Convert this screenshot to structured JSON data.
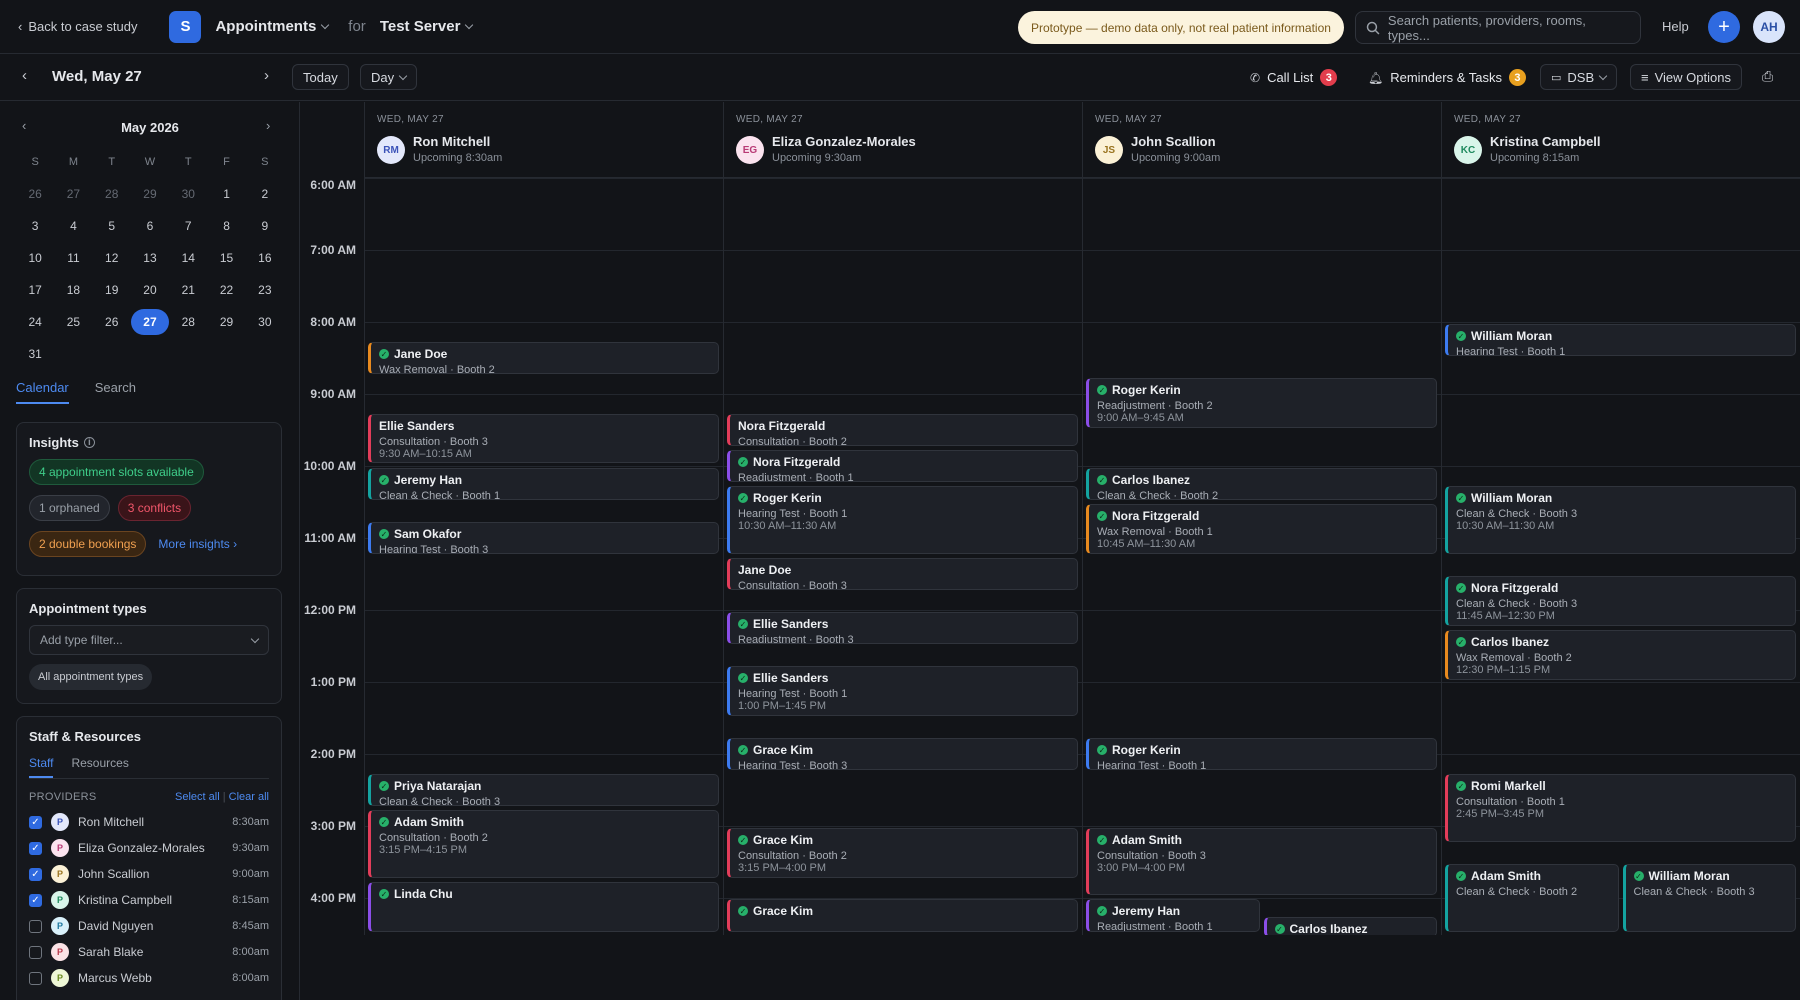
{
  "topbar": {
    "back_label": "Back to case study",
    "logo_letter": "S",
    "app_title": "Appointments",
    "for_label": "for",
    "server": "Test Server",
    "prototype_notice": "Prototype — demo data only, not real patient information",
    "search_placeholder": "Search patients, providers, rooms, types...",
    "help_label": "Help",
    "plus_label": "+",
    "user_initials": "AH"
  },
  "subbar": {
    "date": "Wed, May 27",
    "today_label": "Today",
    "view_label": "Day",
    "call_list_label": "Call List",
    "call_list_count": "3",
    "reminders_label": "Reminders & Tasks",
    "reminders_count": "3",
    "location_label": "DSB",
    "view_options_label": "View Options"
  },
  "mini_calendar": {
    "title": "May 2026",
    "dow": [
      "S",
      "M",
      "T",
      "W",
      "T",
      "F",
      "S"
    ],
    "weeks": [
      [
        "26",
        "27",
        "28",
        "29",
        "30",
        "1",
        "2"
      ],
      [
        "3",
        "4",
        "5",
        "6",
        "7",
        "8",
        "9"
      ],
      [
        "10",
        "11",
        "12",
        "13",
        "14",
        "15",
        "16"
      ],
      [
        "17",
        "18",
        "19",
        "20",
        "21",
        "22",
        "23"
      ],
      [
        "24",
        "25",
        "26",
        "27",
        "28",
        "29",
        "30"
      ],
      [
        "31",
        "",
        "",
        "",
        "",
        "",
        ""
      ]
    ],
    "selected": "27"
  },
  "side_tabs": {
    "calendar": "Calendar",
    "search": "Search"
  },
  "insights": {
    "title": "Insights",
    "slots": "4 appointment slots available",
    "orphaned": "1 orphaned",
    "conflicts": "3 conflicts",
    "double": "2 double bookings",
    "more": "More insights"
  },
  "appt_types": {
    "title": "Appointment types",
    "filter_placeholder": "Add type filter...",
    "all_chip": "All appointment types"
  },
  "staff": {
    "title": "Staff & Resources",
    "tab_staff": "Staff",
    "tab_resources": "Resources",
    "providers_label": "PROVIDERS",
    "select_all": "Select all",
    "clear_all": "Clear all",
    "providers": [
      {
        "name": "Ron Mitchell",
        "time": "8:30am",
        "checked": true,
        "initial": "P",
        "bg": "#e3e8fb",
        "fg": "#3a52b8"
      },
      {
        "name": "Eliza Gonzalez-Morales",
        "time": "9:30am",
        "checked": true,
        "initial": "P",
        "bg": "#fbe3ef",
        "fg": "#b83a75"
      },
      {
        "name": "John Scallion",
        "time": "9:00am",
        "checked": true,
        "initial": "P",
        "bg": "#fbf1d6",
        "fg": "#9a7420"
      },
      {
        "name": "Kristina Campbell",
        "time": "8:15am",
        "checked": true,
        "initial": "P",
        "bg": "#d9f5ea",
        "fg": "#1f8a5e"
      },
      {
        "name": "David Nguyen",
        "time": "8:45am",
        "checked": false,
        "initial": "P",
        "bg": "#d9f1fb",
        "fg": "#1f79a0"
      },
      {
        "name": "Sarah Blake",
        "time": "8:00am",
        "checked": false,
        "initial": "P",
        "bg": "#fbe3e6",
        "fg": "#b83a4c"
      },
      {
        "name": "Marcus Webb",
        "time": "8:00am",
        "checked": false,
        "initial": "P",
        "bg": "#eef7d6",
        "fg": "#6a8a1f"
      }
    ]
  },
  "columns": [
    {
      "date": "WED, MAY 27",
      "initials": "RM",
      "name": "Ron Mitchell",
      "upcoming": "Upcoming 8:30am",
      "bg": "#e3e8fb",
      "fg": "#3a52b8"
    },
    {
      "date": "WED, MAY 27",
      "initials": "EG",
      "name": "Eliza Gonzalez-Morales",
      "upcoming": "Upcoming 9:30am",
      "bg": "#fbe3ef",
      "fg": "#b83a75"
    },
    {
      "date": "WED, MAY 27",
      "initials": "JS",
      "name": "John Scallion",
      "upcoming": "Upcoming 9:00am",
      "bg": "#fbf1d6",
      "fg": "#9a7420"
    },
    {
      "date": "WED, MAY 27",
      "initials": "KC",
      "name": "Kristina Campbell",
      "upcoming": "Upcoming 8:15am",
      "bg": "#d9f5ea",
      "fg": "#1f8a5e"
    }
  ],
  "hours": [
    "6:00 AM",
    "7:00 AM",
    "8:00 AM",
    "9:00 AM",
    "10:00 AM",
    "11:00 AM",
    "12:00 PM",
    "1:00 PM",
    "2:00 PM",
    "3:00 PM",
    "4:00 PM"
  ],
  "colors": {
    "blue": "#3d7bf0",
    "teal": "#14a3a0",
    "red": "#e23d5a",
    "orange": "#e88a1f",
    "purple": "#8b4ee8"
  },
  "appointments": [
    {
      "col": 0,
      "start": 9.25,
      "end": 9.75,
      "name": "Jane Doe",
      "type": "Wax Removal · Booth 2",
      "time": "",
      "color": "orange",
      "check": true
    },
    {
      "col": 0,
      "start": 10.25,
      "end": 10.99,
      "name": "Ellie Sanders",
      "type": "Consultation · Booth 3",
      "time": "9:30 AM–10:15 AM",
      "color": "red",
      "check": false
    },
    {
      "col": 0,
      "start": 11.0,
      "end": 11.5,
      "name": "Jeremy Han",
      "type": "Clean & Check · Booth 1",
      "time": "",
      "color": "teal",
      "check": true
    },
    {
      "col": 0,
      "start": 11.75,
      "end": 12.25,
      "name": "Sam Okafor",
      "type": "Hearing Test · Booth 3",
      "time": "",
      "color": "blue",
      "check": true
    },
    {
      "col": 0,
      "start": 15.25,
      "end": 15.75,
      "name": "Priya Natarajan",
      "type": "Clean & Check · Booth 3",
      "time": "",
      "color": "teal",
      "check": true
    },
    {
      "col": 0,
      "start": 15.75,
      "end": 16.75,
      "name": "Adam Smith",
      "type": "Consultation · Booth 2",
      "time": "3:15 PM–4:15 PM",
      "color": "red",
      "check": true
    },
    {
      "col": 0,
      "start": 16.75,
      "end": 17.5,
      "name": "Linda Chu",
      "type": "",
      "time": "",
      "color": "purple",
      "check": true
    },
    {
      "col": 1,
      "start": 10.25,
      "end": 10.75,
      "name": "Nora Fitzgerald",
      "type": "Consultation · Booth 2",
      "time": "",
      "color": "red",
      "check": false
    },
    {
      "col": 1,
      "start": 10.75,
      "end": 11.25,
      "name": "Nora Fitzgerald",
      "type": "Readjustment · Booth 1",
      "time": "",
      "color": "purple",
      "check": true
    },
    {
      "col": 1,
      "start": 11.25,
      "end": 12.25,
      "name": "Roger Kerin",
      "type": "Hearing Test · Booth 1",
      "time": "10:30 AM–11:30 AM",
      "color": "blue",
      "check": true
    },
    {
      "col": 1,
      "start": 12.25,
      "end": 12.75,
      "name": "Jane Doe",
      "type": "Consultation · Booth 3",
      "time": "",
      "color": "red",
      "check": false
    },
    {
      "col": 1,
      "start": 13.0,
      "end": 13.5,
      "name": "Ellie Sanders",
      "type": "Readjustment · Booth 3",
      "time": "",
      "color": "purple",
      "check": true
    },
    {
      "col": 1,
      "start": 13.75,
      "end": 14.5,
      "name": "Ellie Sanders",
      "type": "Hearing Test · Booth 1",
      "time": "1:00 PM–1:45 PM",
      "color": "blue",
      "check": true
    },
    {
      "col": 1,
      "start": 14.75,
      "end": 15.25,
      "name": "Grace Kim",
      "type": "Hearing Test · Booth 3",
      "time": "",
      "color": "blue",
      "check": true
    },
    {
      "col": 1,
      "start": 16.0,
      "end": 16.75,
      "name": "Grace Kim",
      "type": "Consultation · Booth 2",
      "time": "3:15 PM–4:00 PM",
      "color": "red",
      "check": true
    },
    {
      "col": 1,
      "start": 16.99,
      "end": 17.5,
      "name": "Grace Kim",
      "type": "",
      "time": "",
      "color": "red",
      "check": true
    },
    {
      "col": 2,
      "start": 9.75,
      "end": 10.5,
      "name": "Roger Kerin",
      "type": "Readjustment · Booth 2",
      "time": "9:00 AM–9:45 AM",
      "color": "purple",
      "check": true
    },
    {
      "col": 2,
      "start": 11.0,
      "end": 11.5,
      "name": "Carlos Ibanez",
      "type": "Clean & Check · Booth 2",
      "time": "",
      "color": "teal",
      "check": true
    },
    {
      "col": 2,
      "start": 11.5,
      "end": 12.25,
      "name": "Nora Fitzgerald",
      "type": "Wax Removal · Booth 1",
      "time": "10:45 AM–11:30 AM",
      "color": "orange",
      "check": true
    },
    {
      "col": 2,
      "start": 14.75,
      "end": 15.25,
      "name": "Roger Kerin",
      "type": "Hearing Test · Booth 1",
      "time": "",
      "color": "blue",
      "check": true
    },
    {
      "col": 2,
      "start": 16.0,
      "end": 16.99,
      "name": "Adam Smith",
      "type": "Consultation · Booth 3",
      "time": "3:00 PM–4:00 PM",
      "color": "red",
      "check": true
    },
    {
      "col": 2,
      "start": 16.99,
      "end": 17.5,
      "name": "Jeremy Han",
      "type": "Readjustment · Booth 1",
      "time": "",
      "color": "purple",
      "check": true,
      "half": "left"
    },
    {
      "col": 2,
      "start": 17.24,
      "end": 17.5,
      "name": "Carlos Ibanez",
      "type": "",
      "time": "",
      "color": "purple",
      "check": true,
      "half": "right"
    },
    {
      "col": 3,
      "start": 9.0,
      "end": 9.5,
      "name": "William Moran",
      "type": "Hearing Test · Booth 1",
      "time": "",
      "color": "blue",
      "check": true
    },
    {
      "col": 3,
      "start": 11.25,
      "end": 12.25,
      "name": "William Moran",
      "type": "Clean & Check · Booth 3",
      "time": "10:30 AM–11:30 AM",
      "color": "teal",
      "check": true
    },
    {
      "col": 3,
      "start": 12.5,
      "end": 13.25,
      "name": "Nora Fitzgerald",
      "type": "Clean & Check · Booth 3",
      "time": "11:45 AM–12:30 PM",
      "color": "teal",
      "check": true
    },
    {
      "col": 3,
      "start": 13.25,
      "end": 14.0,
      "name": "Carlos Ibanez",
      "type": "Wax Removal · Booth 2",
      "time": "12:30 PM–1:15 PM",
      "color": "orange",
      "check": true
    },
    {
      "col": 3,
      "start": 15.25,
      "end": 16.25,
      "name": "Romi Markell",
      "type": "Consultation · Booth 1",
      "time": "2:45 PM–3:45 PM",
      "color": "red",
      "check": true
    },
    {
      "col": 3,
      "start": 16.5,
      "end": 17.5,
      "name": "Adam Smith",
      "type": "Clean & Check · Booth 2",
      "time": "",
      "color": "teal",
      "check": true,
      "half": "left"
    },
    {
      "col": 3,
      "start": 16.5,
      "end": 17.5,
      "name": "William Moran",
      "type": "Clean & Check · Booth 3",
      "time": "",
      "color": "teal",
      "check": true,
      "half": "right"
    }
  ]
}
